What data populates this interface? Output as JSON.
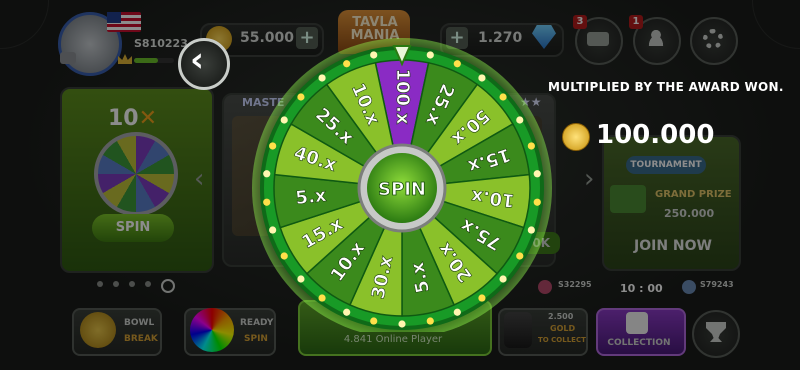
{
  "header": {
    "player_id": "S810223",
    "coins": "55.000",
    "gems": "1.270",
    "logo": "TAVLA MANIA",
    "inventory_badge": "3",
    "friends_badge": "1"
  },
  "spin_card": {
    "multiplier": "10",
    "spin_label": "SPIN"
  },
  "middle_card": {
    "title": "MASTE"
  },
  "right_card": {
    "tournament_label": "TOURNAMENT",
    "grand_prize_label": "GRAND PRIZE",
    "grand_prize_value": "250.000",
    "join_label": "JOIN NOW",
    "stake": "50K"
  },
  "award_panel": {
    "caption": "MULTIPLIED BY THE AWARD WON.",
    "amount": "100.000"
  },
  "wheel": {
    "center_label": "SPIN",
    "segments": [
      "100.x",
      "25.x",
      "50.x",
      "15.x",
      "10.x",
      "75.x",
      "20.x",
      "5.x",
      "30.x",
      "10.x",
      "15.x",
      "5.x",
      "40.x",
      "25.x",
      "10.x"
    ],
    "highlight_index": 0,
    "colors": {
      "light": "#8ac12a",
      "dark": "#3b8a1c",
      "highlight": "#8a2bc4",
      "rim": "#1fa22a"
    }
  },
  "match_bar": {
    "left_player": "S32295",
    "right_player": "S79243",
    "score": "10 : 00"
  },
  "bottom": {
    "bowl_line1": "BOWL",
    "bowl_line2": "BREAK",
    "ready_line1": "READY",
    "ready_line2": "SPIN",
    "online": "4.841 Online Player",
    "gold_line1": "2.500",
    "gold_line2": "GOLD",
    "gold_line3": "TO COLLECT",
    "collection_label": "COLLECTION"
  },
  "page_dots": {
    "count": 5,
    "active": 4
  }
}
